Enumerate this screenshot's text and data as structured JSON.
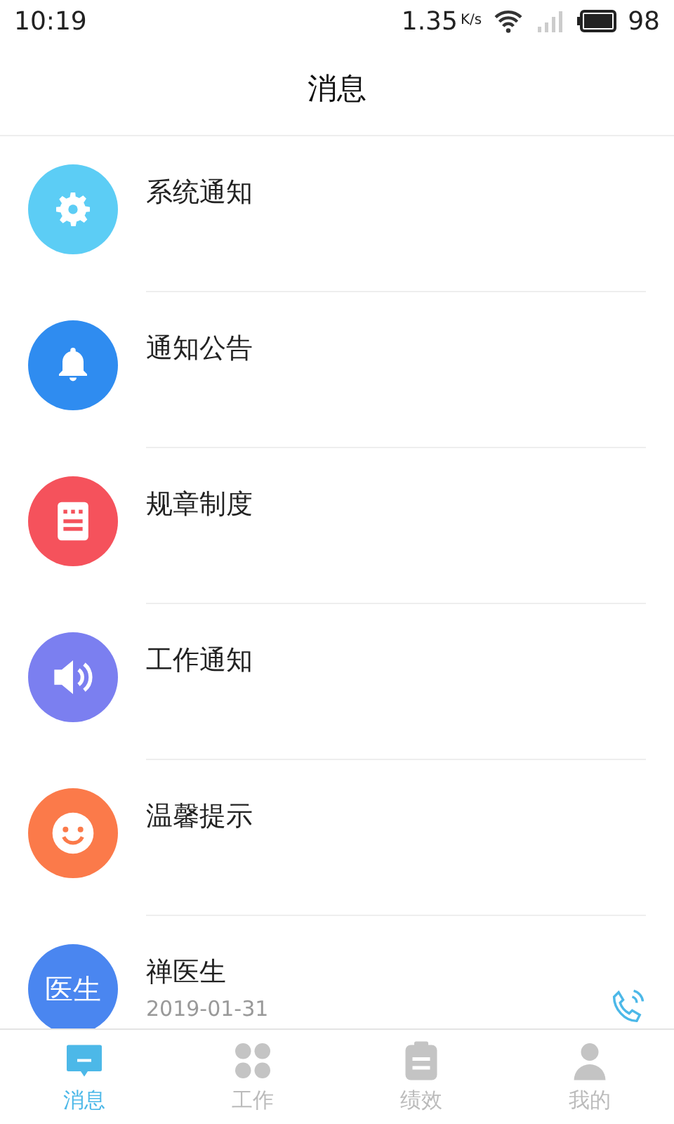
{
  "status_bar": {
    "time": "10:19",
    "speed": "1.35",
    "speed_unit": "K/s",
    "battery": "98"
  },
  "header": {
    "title": "消息"
  },
  "messages": [
    {
      "kind": "category",
      "title": "系统通知",
      "color": "#5ccdf5"
    },
    {
      "kind": "category",
      "title": "通知公告",
      "color": "#2f8cf0"
    },
    {
      "kind": "category",
      "title": "规章制度",
      "color": "#f5525c"
    },
    {
      "kind": "category",
      "title": "工作通知",
      "color": "#7b7ff0"
    },
    {
      "kind": "category",
      "title": "温馨提示",
      "color": "#fb7a4a"
    },
    {
      "kind": "contact",
      "title": "禅医生",
      "avatar": "医生",
      "date": "2019-01-31",
      "color": "#4a86f0"
    }
  ],
  "tabs": [
    {
      "label": "消息",
      "selected": true
    },
    {
      "label": "工作",
      "selected": false
    },
    {
      "label": "绩效",
      "selected": false
    },
    {
      "label": "我的",
      "selected": false
    }
  ]
}
